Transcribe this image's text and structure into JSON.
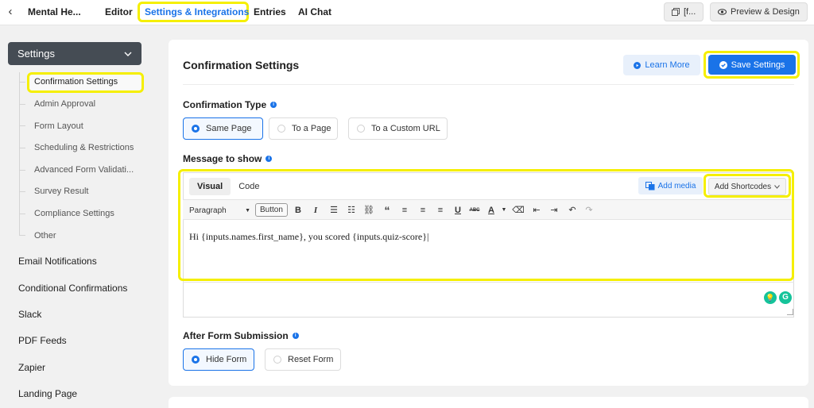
{
  "topbar": {
    "back_glyph": "‹",
    "form_name": "Mental He...",
    "tabs": [
      {
        "label": "Editor"
      },
      {
        "label": "Settings & Integrations"
      },
      {
        "label": "Entries"
      },
      {
        "label": "AI Chat"
      }
    ],
    "shortcode_button": "[f...",
    "preview_button": "Preview & Design"
  },
  "sidebar": {
    "settings_label": "Settings",
    "settings_items": [
      {
        "label": "Confirmation Settings"
      },
      {
        "label": "Admin Approval"
      },
      {
        "label": "Form Layout"
      },
      {
        "label": "Scheduling & Restrictions"
      },
      {
        "label": "Advanced Form Validati..."
      },
      {
        "label": "Survey Result"
      },
      {
        "label": "Compliance Settings"
      },
      {
        "label": "Other"
      }
    ],
    "main_items": [
      {
        "label": "Email Notifications"
      },
      {
        "label": "Conditional Confirmations"
      },
      {
        "label": "Slack"
      },
      {
        "label": "PDF Feeds"
      },
      {
        "label": "Zapier"
      },
      {
        "label": "Landing Page"
      }
    ]
  },
  "main": {
    "title": "Confirmation Settings",
    "learn_more": "Learn More",
    "save_settings": "Save Settings",
    "confirmation_type_label": "Confirmation Type",
    "confirmation_options": [
      {
        "label": "Same Page",
        "selected": true
      },
      {
        "label": "To a Page",
        "selected": false
      },
      {
        "label": "To a Custom URL",
        "selected": false
      }
    ],
    "message_label": "Message to show",
    "editor": {
      "tabs": [
        {
          "label": "Visual"
        },
        {
          "label": "Code"
        }
      ],
      "add_media": "Add media",
      "add_shortcodes": "Add Shortcodes",
      "format_select": "Paragraph",
      "button_label": "Button",
      "content": "Hi {inputs.names.first_name}, you scored {inputs.quiz-score}|"
    },
    "after_submission_label": "After Form Submission",
    "after_submission_options": [
      {
        "label": "Hide Form",
        "selected": true
      },
      {
        "label": "Reset Form",
        "selected": false
      }
    ]
  },
  "colors": {
    "accent": "#1a73e8",
    "highlight": "#f5ef00",
    "sidebar_header": "#454c54"
  }
}
